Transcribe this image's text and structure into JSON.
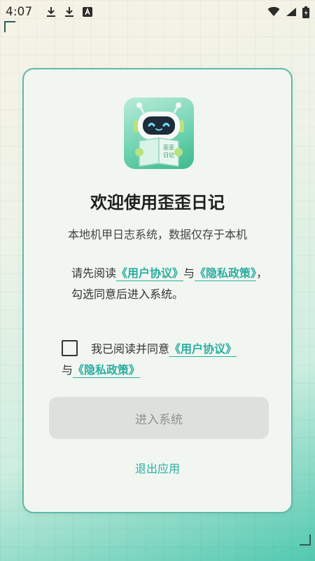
{
  "status_bar": {
    "time": "4:07",
    "left_icons": [
      "download-icon",
      "download-icon",
      "a-box-icon"
    ],
    "right_icons": [
      "wifi-icon",
      "signal-icon",
      "battery-icon"
    ]
  },
  "logo": {
    "name": "robot-diary-logo",
    "text": "歪歪日记"
  },
  "welcome": {
    "title": "欢迎使用歪歪日记",
    "subtitle": "本地机甲日志系统，数据仅存于本机"
  },
  "intro": {
    "prefix": "请先阅读",
    "user_agreement": "《用户协议》",
    "and": "与",
    "privacy_policy": "《隐私政策》",
    "suffix": "，勾选同意后进入系统。"
  },
  "agree": {
    "checked": false,
    "prefix": "我已阅读并同意",
    "user_agreement": "《用户协议》",
    "and": "与",
    "privacy_policy": "《隐私政策》"
  },
  "buttons": {
    "enter": "进入系统",
    "exit": "退出应用"
  },
  "colors": {
    "accent": "#2aaea0",
    "card_border": "#5fb9a8",
    "button_disabled_bg": "#dde1de",
    "button_disabled_text": "#8d928f"
  }
}
